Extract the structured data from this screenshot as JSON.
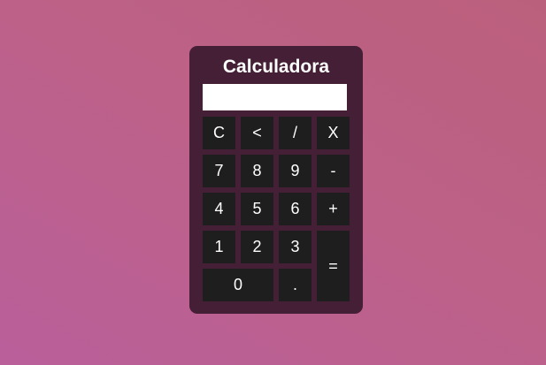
{
  "calculator": {
    "title": "Calculadora",
    "display_value": "",
    "buttons": {
      "clear": "C",
      "backspace": "<",
      "divide": "/",
      "multiply": "X",
      "seven": "7",
      "eight": "8",
      "nine": "9",
      "minus": "-",
      "four": "4",
      "five": "5",
      "six": "6",
      "plus": "+",
      "one": "1",
      "two": "2",
      "three": "3",
      "equals": "=",
      "zero": "0",
      "decimal": "."
    }
  }
}
